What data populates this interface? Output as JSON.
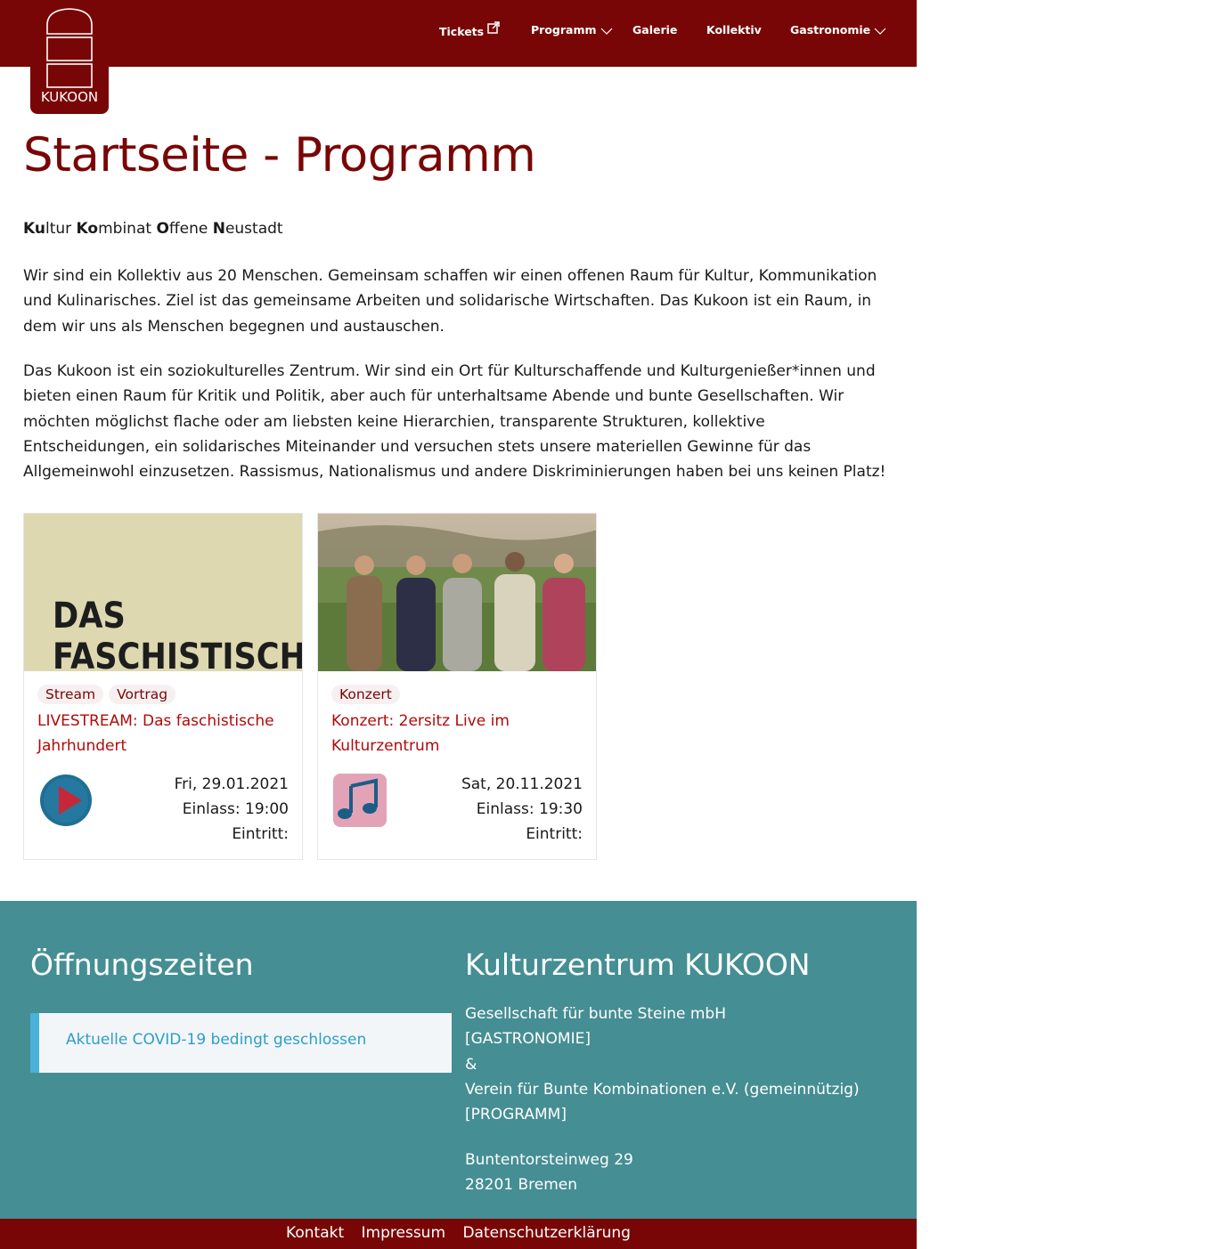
{
  "header": {
    "logo_text": "KUKOON",
    "nav": [
      {
        "label": "Tickets",
        "icon": "external-link-icon"
      },
      {
        "label": "Programm",
        "icon": "chevron-down-icon"
      },
      {
        "label": "Galerie"
      },
      {
        "label": "Kollektiv"
      },
      {
        "label": "Gastronomie",
        "icon": "chevron-down-icon"
      }
    ]
  },
  "main": {
    "title": "Startseite - Programm",
    "lead": {
      "parts": [
        {
          "bold": "Ku",
          "rest": "ltur "
        },
        {
          "bold": "Ko",
          "rest": "mbinat "
        },
        {
          "bold": "O",
          "rest": "ffene "
        },
        {
          "bold": "N",
          "rest": "eustadt"
        }
      ]
    },
    "paragraph1": "Wir sind ein Kollektiv aus 20 Menschen. Gemeinsam schaffen wir einen offenen Raum für Kultur, Kommunikation und Kulinarisches. Ziel ist das gemeinsame Arbeiten und solidarische Wirtschaften. Das Kukoon ist ein Raum, in dem wir uns als Menschen begegnen und austauschen.",
    "paragraph2": "Das Kukoon ist ein soziokulturelles Zentrum. Wir sind ein Ort für Kulturschaffende und Kulturgenießer*innen und bieten einen Raum für Kritik und Politik, aber auch für unterhaltsame Abende und bunte Gesellschaften. Wir möchten möglichst flache oder am liebsten keine Hierarchien, transparente Strukturen, kollektive Entscheidungen, ein solidarisches Miteinander und versuchen stets unsere materiellen Gewinne für das Allgemeinwohl einzusetzen. Rassismus, Nationalismus und andere Diskriminierungen haben bei uns keinen Platz!"
  },
  "events": [
    {
      "image_text_line1": "DAS",
      "image_text_line2": "FASCHISTISCHE",
      "tags": [
        "Stream",
        "Vortrag"
      ],
      "title": "LIVESTREAM: Das faschistische Jahrhundert",
      "icon": "play-icon",
      "date": "Fri, 29.01.2021",
      "einlass": "Einlass: 19:00",
      "eintritt": "Eintritt:"
    },
    {
      "tags": [
        "Konzert"
      ],
      "title": "Konzert: 2ersitz Live im Kulturzentrum",
      "icon": "music-note-icon",
      "date": "Sat, 20.11.2021",
      "einlass": "Einlass: 19:30",
      "eintritt": "Eintritt:"
    }
  ],
  "footer": {
    "hours_title": "Öffnungszeiten",
    "notice": "Aktuelle COVID-19 bedingt geschlossen",
    "org_title": "Kulturzentrum KUKOON",
    "org_lines": [
      "Gesellschaft für bunte Steine mbH",
      "[GASTRONOMIE]",
      "&",
      "Verein für Bunte Kombinationen e.V. (gemeinnützig)",
      "[PROGRAMM]"
    ],
    "address_lines": [
      "Buntentorsteinweg 29",
      "28201 Bremen"
    ],
    "links": [
      "Kontakt",
      "Impressum",
      "Datenschutzerklärung"
    ]
  },
  "colors": {
    "brand": "#790606",
    "footer_bg": "#458e93",
    "notice_accent": "#48b2d9"
  }
}
